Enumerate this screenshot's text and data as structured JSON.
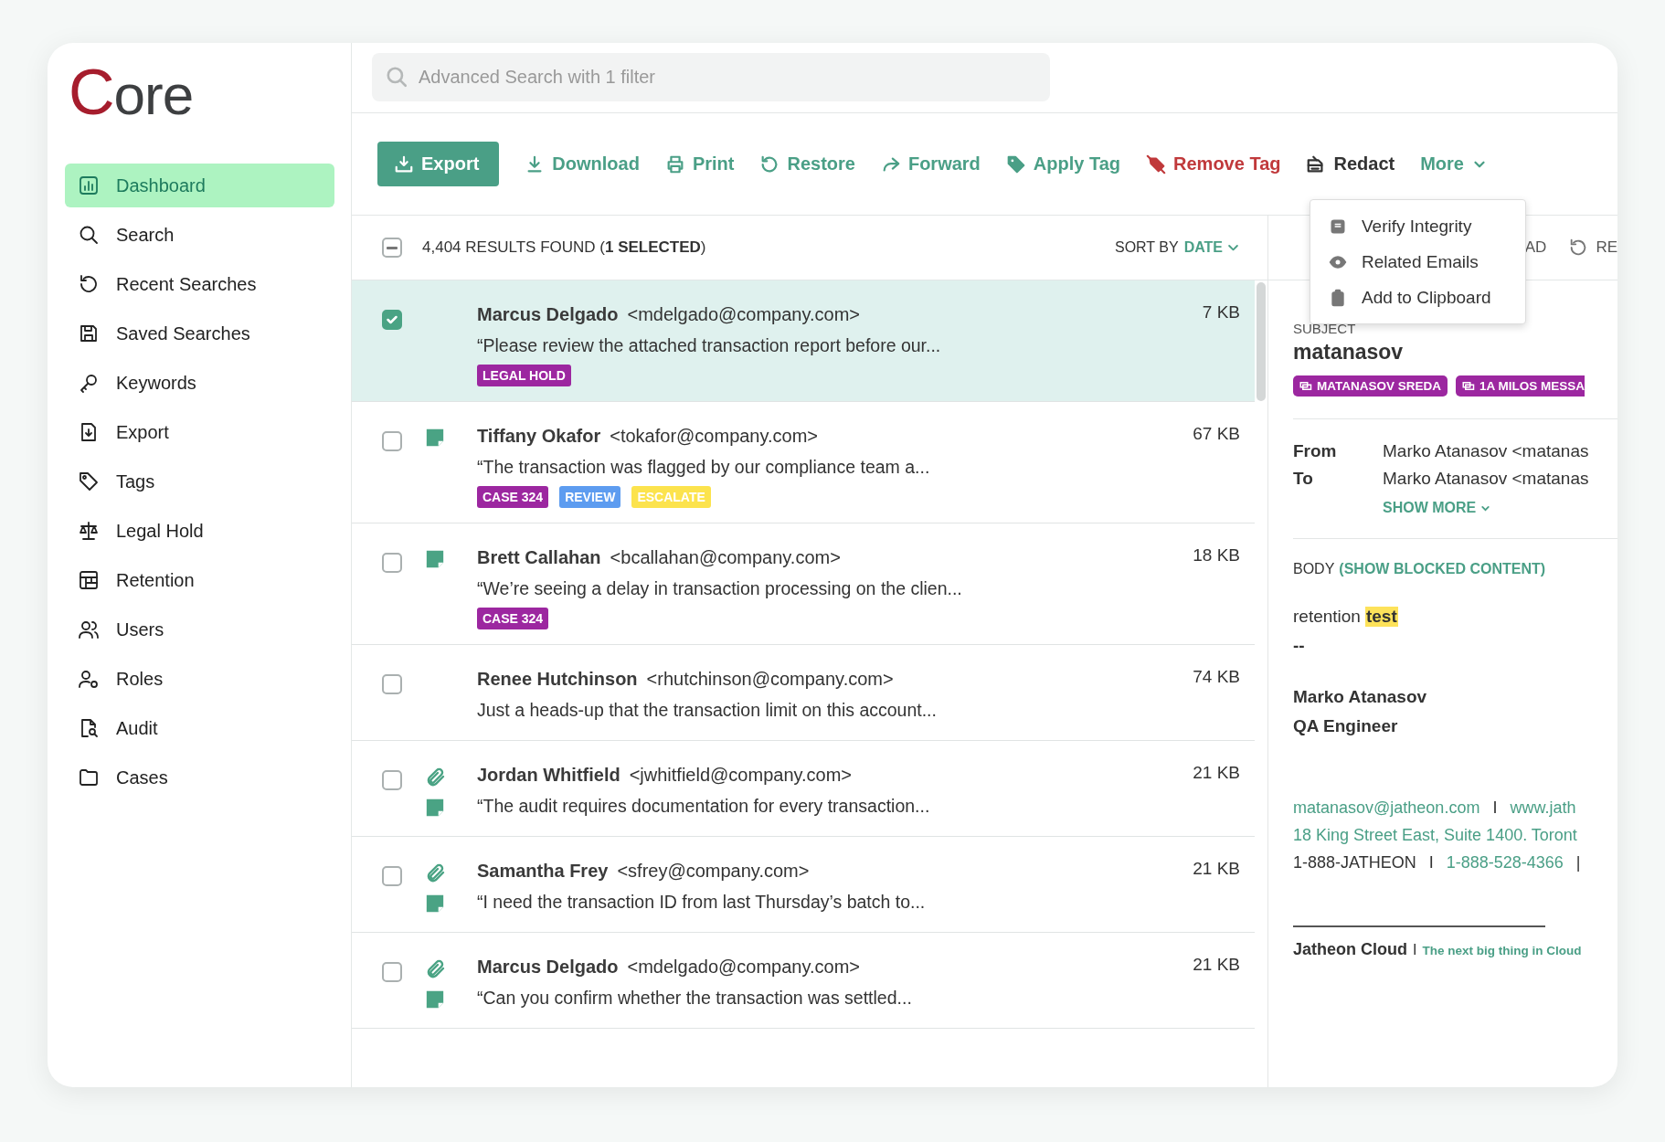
{
  "logo": {
    "text": "Core"
  },
  "sidebar": {
    "items": [
      {
        "label": "Dashboard",
        "selected": true
      },
      {
        "label": "Search",
        "selected": false
      },
      {
        "label": "Recent Searches",
        "selected": false
      },
      {
        "label": "Saved Searches",
        "selected": false
      },
      {
        "label": "Keywords",
        "selected": false
      },
      {
        "label": "Export",
        "selected": false
      },
      {
        "label": "Tags",
        "selected": false
      },
      {
        "label": "Legal Hold",
        "selected": false
      },
      {
        "label": "Retention",
        "selected": false
      },
      {
        "label": "Users",
        "selected": false
      },
      {
        "label": "Roles",
        "selected": false
      },
      {
        "label": "Audit",
        "selected": false
      },
      {
        "label": "Cases",
        "selected": false
      }
    ]
  },
  "search": {
    "placeholder": "Advanced Search with 1 filter"
  },
  "toolbar": {
    "actions": [
      {
        "label": "Export",
        "kind": "primary"
      },
      {
        "label": "Download",
        "kind": "link"
      },
      {
        "label": "Print",
        "kind": "link"
      },
      {
        "label": "Restore",
        "kind": "link"
      },
      {
        "label": "Forward",
        "kind": "link"
      },
      {
        "label": "Apply Tag",
        "kind": "link"
      },
      {
        "label": "Remove Tag",
        "kind": "danger"
      },
      {
        "label": "Redact",
        "kind": "neutral"
      },
      {
        "label": "More",
        "kind": "dropdown"
      }
    ]
  },
  "more_menu": {
    "items": [
      {
        "label": "Verify Integrity"
      },
      {
        "label": "Related Emails"
      },
      {
        "label": "Add to Clipboard"
      }
    ]
  },
  "results": {
    "select_all": {
      "indeterminate": true
    },
    "summary": "4,404 RESULTS FOUND (**1 SELECTED**)",
    "sort_label": "SORT BY",
    "sort_value": "DATE"
  },
  "emails": [
    {
      "name": "Marcus Delgado",
      "email": "<mdelgado@company.com>",
      "preview": "“Please review the attached transaction report before our...",
      "size": "7 KB",
      "selected": true,
      "attachment": false,
      "note": false,
      "tags": [
        {
          "label": "LEGAL HOLD",
          "color": "#9c27a0"
        }
      ]
    },
    {
      "name": "Tiffany Okafor",
      "email": "<tokafor@company.com>",
      "preview": "“The transaction was flagged by our compliance team a...",
      "size": "67 KB",
      "selected": false,
      "attachment": false,
      "note": true,
      "tags": [
        {
          "label": "CASE 324",
          "color": "#9c27a0"
        },
        {
          "label": "REVIEW",
          "color": "#5d9cf0"
        },
        {
          "label": "ESCALATE",
          "color": "#fce34d"
        }
      ]
    },
    {
      "name": "Brett Callahan",
      "email": "<bcallahan@company.com>",
      "preview": "“We’re seeing a delay in transaction processing on the clien...",
      "size": "18 KB",
      "selected": false,
      "attachment": false,
      "note": true,
      "tags": [
        {
          "label": "CASE 324",
          "color": "#9c27a0"
        }
      ]
    },
    {
      "name": "Renee Hutchinson",
      "email": "<rhutchinson@company.com>",
      "preview": "Just a heads-up that the transaction limit on this account...",
      "size": "74 KB",
      "selected": false,
      "attachment": false,
      "note": false
    },
    {
      "name": "Jordan Whitfield",
      "email": "<jwhitfield@company.com>",
      "preview": "“The audit requires documentation for every transaction...",
      "size": "21 KB",
      "selected": false,
      "attachment": true,
      "note": true
    },
    {
      "name": "Samantha Frey",
      "email": "<sfrey@company.com>",
      "preview": "“I need the transaction ID from last Thursday’s batch to...",
      "size": "21 KB",
      "selected": false,
      "attachment": true,
      "note": true
    },
    {
      "name": "Marcus Delgado",
      "email": "<mdelgado@company.com>",
      "preview": "“Can you confirm whether the transaction was settled...",
      "size": "21 KB",
      "selected": false,
      "attachment": true,
      "note": true
    }
  ],
  "detail": {
    "actions": [
      "AD",
      "RE"
    ],
    "subject_label": "SUBJECT",
    "subject": "matanasov",
    "labels": [
      "MATANASOV SREDA",
      "1A MILOS MESSA"
    ],
    "fields": [
      {
        "label": "From",
        "value": "Marko Atanasov <matanas"
      },
      {
        "label": "To",
        "value": "Marko Atanasov <matanas"
      }
    ],
    "show_more": "SHOW MORE",
    "body_label": "BODY",
    "blocked_link": "(SHOW BLOCKED CONTENT)",
    "body": {
      "text": "retention",
      "highlight": "test"
    },
    "separator": "--",
    "signature": {
      "name": "Marko Atanasov",
      "title": "QA Engineer",
      "lines": [
        [
          {
            "text": "matanasov@jatheon.com",
            "kind": "link"
          },
          {
            "text": "I",
            "kind": "sep"
          },
          {
            "text": "www.jath",
            "kind": "link"
          }
        ],
        [
          {
            "text": "18 King Street East, Suite 1400. Toront",
            "kind": "link"
          }
        ],
        [
          {
            "text": "1-888-JATHEON",
            "kind": "plain"
          },
          {
            "text": "I",
            "kind": "sep"
          },
          {
            "text": "1-888-528-4366",
            "kind": "link"
          },
          {
            "text": "|",
            "kind": "sep"
          }
        ]
      ],
      "company": "Jatheon Cloud",
      "divider": "I",
      "tagline": "The next big thing in Cloud"
    }
  }
}
